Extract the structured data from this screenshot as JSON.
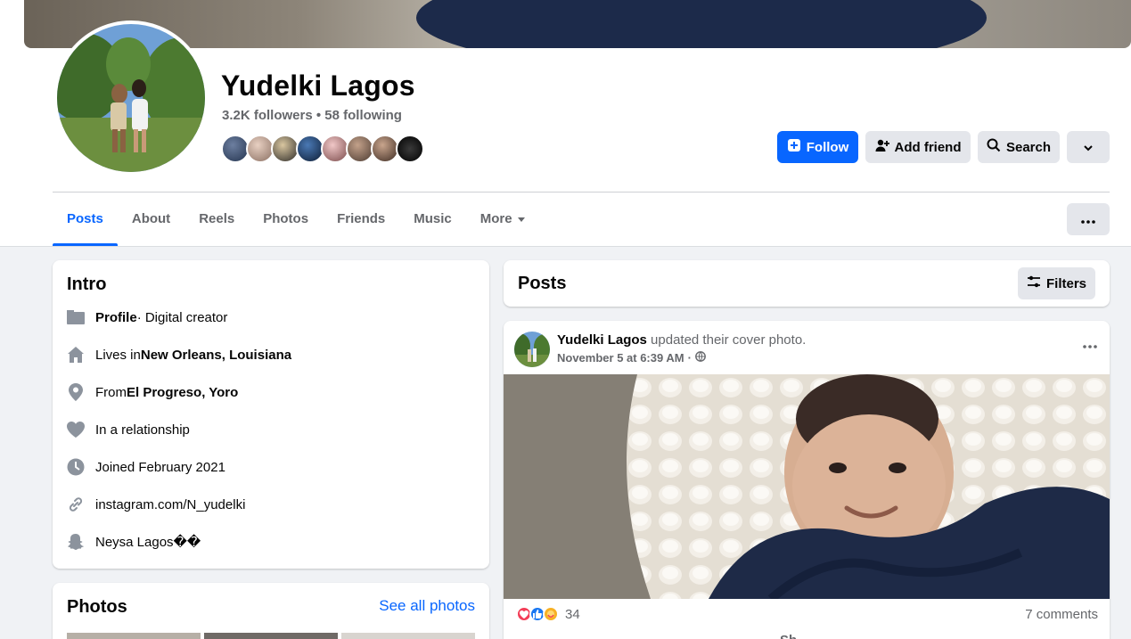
{
  "profile": {
    "name": "Yudelki Lagos",
    "followers_line": "3.2K followers • 58 following"
  },
  "actions": {
    "follow": "Follow",
    "add_friend": "Add friend",
    "search": "Search"
  },
  "tabs": [
    {
      "label": "Posts",
      "active": true
    },
    {
      "label": "About"
    },
    {
      "label": "Reels"
    },
    {
      "label": "Photos"
    },
    {
      "label": "Friends"
    },
    {
      "label": "Music"
    },
    {
      "label": "More"
    }
  ],
  "intro": {
    "title": "Intro",
    "profile_label": "Profile",
    "profile_value": " · Digital creator",
    "lives_prefix": "Lives in ",
    "lives_value": "New Orleans, Louisiana",
    "from_prefix": "From ",
    "from_value": "El Progreso, Yoro",
    "relationship": "In a relationship",
    "joined": "Joined February 2021",
    "link": "instagram.com/N_yudelki",
    "snapchat": "Neysa Lagos��"
  },
  "photos": {
    "title": "Photos",
    "see_all": "See all photos"
  },
  "posts": {
    "title": "Posts",
    "filters": "Filters"
  },
  "post": {
    "author": "Yudelki Lagos",
    "action": " updated their cover photo.",
    "date": "November 5 at 6:39 AM",
    "separator": "·",
    "reaction_count": "34",
    "comments": "7 comments",
    "share_label": "Sh"
  },
  "colors": {
    "accent": "#0866ff",
    "secondary_text": "#65676b",
    "page_bg": "#f0f2f5"
  }
}
